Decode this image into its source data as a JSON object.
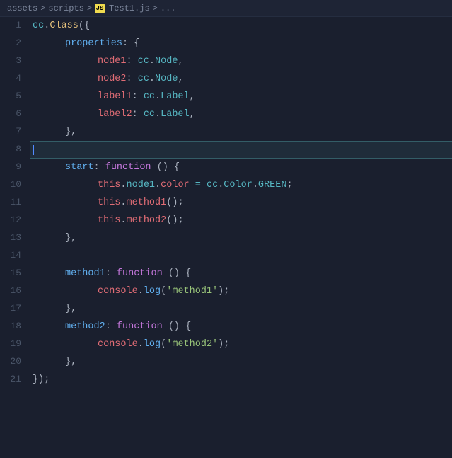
{
  "breadcrumb": {
    "path": "assets",
    "sep1": ">",
    "folder": "scripts",
    "sep2": ">",
    "file": "Test1.js",
    "sep3": ">",
    "ellipsis": "..."
  },
  "editor": {
    "lines": [
      {
        "num": 1,
        "content": "cc.Class({",
        "active": false
      },
      {
        "num": 2,
        "content": "    properties: {",
        "active": false
      },
      {
        "num": 3,
        "content": "        node1: cc.Node,",
        "active": false
      },
      {
        "num": 4,
        "content": "        node2: cc.Node,",
        "active": false
      },
      {
        "num": 5,
        "content": "        label1: cc.Label,",
        "active": false
      },
      {
        "num": 6,
        "content": "        label2: cc.Label,",
        "active": false
      },
      {
        "num": 7,
        "content": "    },",
        "active": false
      },
      {
        "num": 8,
        "content": "",
        "active": true
      },
      {
        "num": 9,
        "content": "    start: function () {",
        "active": false
      },
      {
        "num": 10,
        "content": "        this.node1.color = cc.Color.GREEN;",
        "active": false
      },
      {
        "num": 11,
        "content": "        this.method1();",
        "active": false
      },
      {
        "num": 12,
        "content": "        this.method2();",
        "active": false
      },
      {
        "num": 13,
        "content": "    },",
        "active": false
      },
      {
        "num": 14,
        "content": "",
        "active": false
      },
      {
        "num": 15,
        "content": "    method1: function () {",
        "active": false
      },
      {
        "num": 16,
        "content": "        console.log('method1');",
        "active": false
      },
      {
        "num": 17,
        "content": "    },",
        "active": false
      },
      {
        "num": 18,
        "content": "    method2: function () {",
        "active": false
      },
      {
        "num": 19,
        "content": "        console.log('method2');",
        "active": false
      },
      {
        "num": 20,
        "content": "    },",
        "active": false
      },
      {
        "num": 21,
        "content": "});",
        "active": false
      }
    ]
  }
}
